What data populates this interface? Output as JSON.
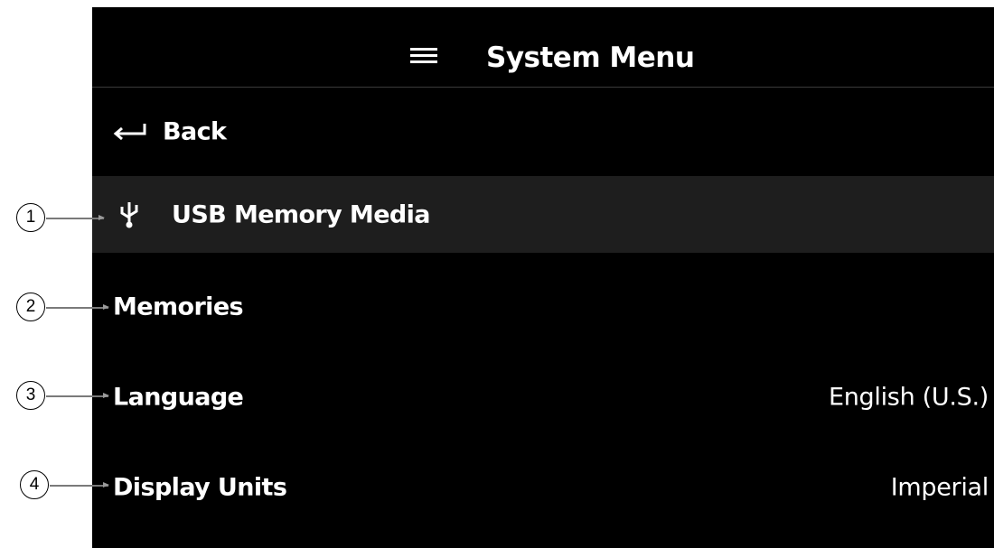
{
  "header": {
    "title": "System Menu",
    "menu_icon": "hamburger-icon"
  },
  "menu": {
    "back": {
      "label": "Back",
      "icon": "return-arrow-icon"
    },
    "usb": {
      "label": "USB Memory Media",
      "icon": "usb-icon"
    },
    "memories": {
      "label": "Memories"
    },
    "language": {
      "label": "Language",
      "value": "English (U.S.)"
    },
    "display_units": {
      "label": "Display Units",
      "value": "Imperial"
    }
  },
  "callouts": [
    "1",
    "2",
    "3",
    "4"
  ],
  "colors": {
    "screen_bg": "#000000",
    "selected_row_bg": "#1e1e1e",
    "text": "#ffffff"
  }
}
